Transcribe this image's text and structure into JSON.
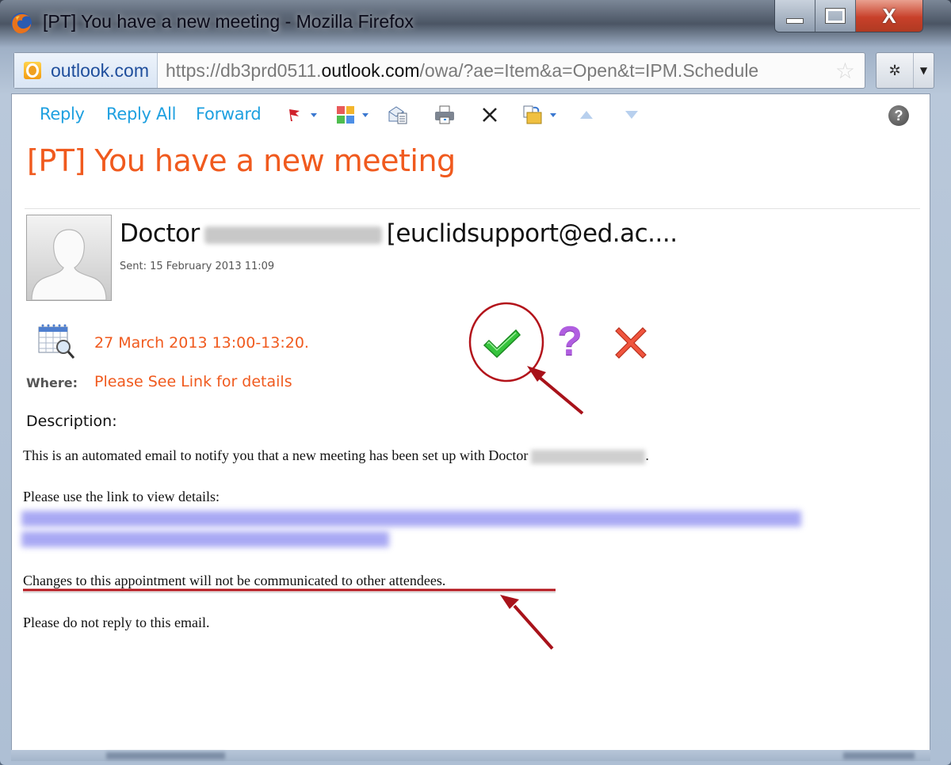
{
  "window": {
    "title": "[PT] You have a new meeting - Mozilla Firefox",
    "controls": {
      "minimize": "minimize",
      "maximize": "maximize",
      "close": "X"
    }
  },
  "urlbar": {
    "site_identity": "outlook.com",
    "url_prefix": "https://db3prd0511.",
    "url_domain": "outlook.com",
    "url_suffix": "/owa/?ae=Item&a=Open&t=IPM.Schedule"
  },
  "toolbar": {
    "reply": "Reply",
    "reply_all": "Reply All",
    "forward": "Forward",
    "icons": [
      "flag-icon",
      "categories-icon",
      "mark-unread-icon",
      "print-icon",
      "delete-icon",
      "move-to-folder-icon",
      "previous-item-icon",
      "next-item-icon",
      "help-icon"
    ],
    "help_label": "?"
  },
  "message": {
    "subject": "[PT] You have a new meeting",
    "sender_prefix": "Doctor",
    "sender_email": "[euclidsupport@ed.ac....",
    "sent": "Sent: 15 February 2013 11:09",
    "when": "27 March 2013 13:00-13:20.",
    "where_label": "Where:",
    "where_value": "Please See Link for details",
    "description_label": "Description:",
    "response_buttons": {
      "accept": "accept",
      "tentative": "?",
      "decline": "decline"
    },
    "body": {
      "line1": "This is an automated email to notify you that a new meeting has been set up with Doctor",
      "line1_end": ".",
      "line2": "Please use the link to view details:",
      "line3": "Changes to this appointment will not be communicated to other attendees.",
      "line4": "Please do not reply to this email."
    }
  },
  "colors": {
    "accent_orange": "#f05a1e",
    "toolbar_link_blue": "#1ea0e0",
    "annotation_red": "#b3141b",
    "accept_green": "#2fbf3a",
    "tentative_purple": "#b05ee0",
    "decline_red": "#e8503a"
  }
}
